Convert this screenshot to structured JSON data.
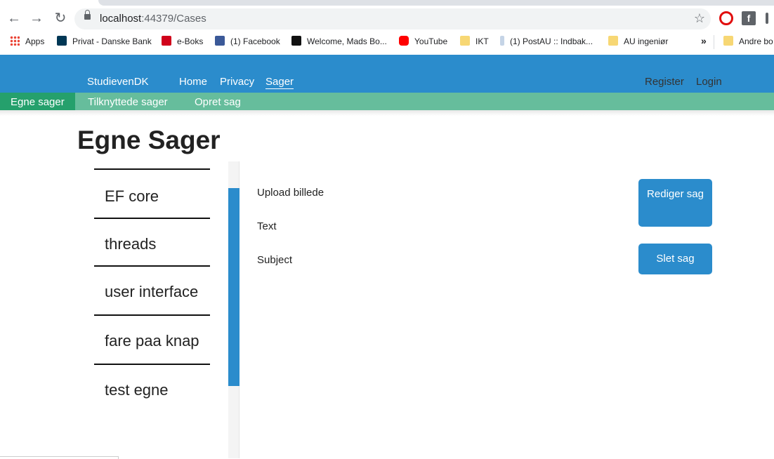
{
  "browser": {
    "url_host": "localhost",
    "url_path": ":44379/Cases",
    "bookmarks": [
      {
        "label": "Apps",
        "icon": "apps-grid-icon"
      },
      {
        "label": "Privat - Danske Bank",
        "icon": "danske-bank-icon"
      },
      {
        "label": "e-Boks",
        "icon": "eboks-icon"
      },
      {
        "label": "(1) Facebook",
        "icon": "facebook-icon"
      },
      {
        "label": "Welcome, Mads Bo...",
        "icon": "blackboard-icon"
      },
      {
        "label": "YouTube",
        "icon": "youtube-icon"
      },
      {
        "label": "IKT",
        "icon": "folder-icon"
      },
      {
        "label": "(1) PostAU :: Indbak...",
        "icon": "postau-icon"
      },
      {
        "label": "AU ingeniør",
        "icon": "folder-icon"
      },
      {
        "label": "Andre bo",
        "icon": "folder-icon"
      }
    ],
    "more_label": "»"
  },
  "navbar": {
    "brand": "StudievenDK",
    "links": [
      "Home",
      "Privacy",
      "Sager"
    ],
    "register": "Register",
    "login": "Login"
  },
  "subnav": {
    "items": [
      "Egne sager",
      "Tilknyttede sager",
      "Opret sag"
    ]
  },
  "page": {
    "title": "Egne Sager",
    "cases": [
      "EF core",
      "threads",
      "user interface",
      "fare paa knap",
      "test egne"
    ],
    "detail": {
      "upload_label": "Upload billede",
      "text_label": "Text",
      "subject_label": "Subject"
    },
    "buttons": {
      "edit": "Rediger sag",
      "delete": "Slet sag"
    }
  },
  "colors": {
    "primary": "#2b8ccc",
    "subnav": "#66bd9c",
    "subnav_active": "#25a06c"
  }
}
